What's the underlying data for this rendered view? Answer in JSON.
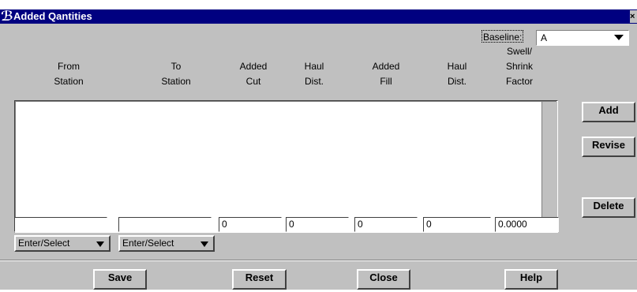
{
  "window": {
    "title": "Added Qantities",
    "app_icon": "bentley-b-icon",
    "close_glyph": "×",
    "colors": {
      "titlebar": "#000080",
      "face": "#c0c0c0"
    }
  },
  "baseline": {
    "label": "Baseline:",
    "value": "A"
  },
  "columns": [
    {
      "lines": [
        "",
        "From",
        "Station"
      ]
    },
    {
      "lines": [
        "",
        "To",
        "Station"
      ]
    },
    {
      "lines": [
        "",
        "Added",
        "Cut"
      ]
    },
    {
      "lines": [
        "",
        "Haul",
        "Dist."
      ]
    },
    {
      "lines": [
        "",
        "Added",
        "Fill"
      ]
    },
    {
      "lines": [
        "",
        "Haul",
        "Dist."
      ]
    },
    {
      "lines": [
        "Swell/",
        "Shrink",
        "Factor"
      ]
    }
  ],
  "side_buttons": {
    "add": "Add",
    "revise": "Revise",
    "delete": "Delete"
  },
  "fields": {
    "from_station": "",
    "to_station": "",
    "added_cut": "0",
    "haul_dist_cut": "0",
    "added_fill": "0",
    "haul_dist_fill": "0",
    "swell_shrink": "0.0000"
  },
  "enter_select": {
    "from": "Enter/Select",
    "to": "Enter/Select"
  },
  "bottom_buttons": {
    "save": "Save",
    "reset": "Reset",
    "close": "Close",
    "help": "Help"
  }
}
